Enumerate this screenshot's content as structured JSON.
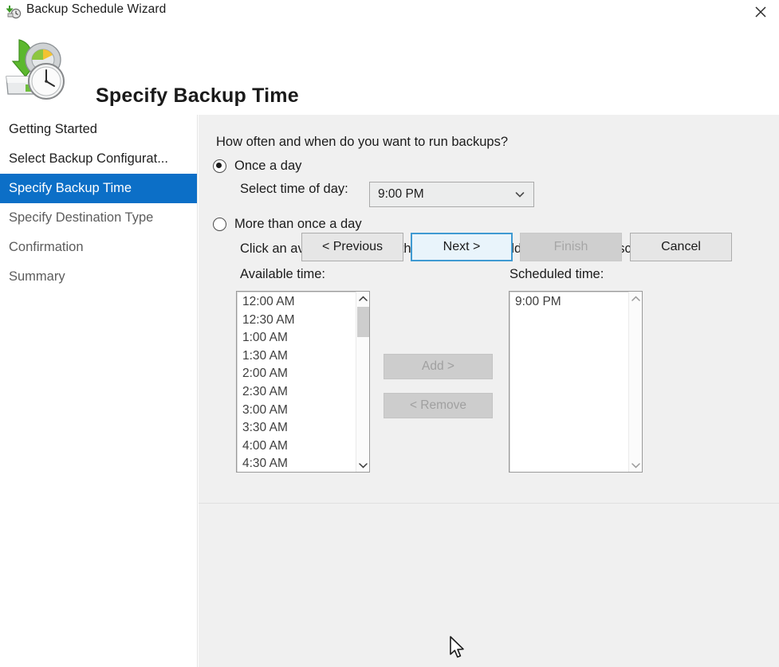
{
  "window": {
    "title": "Backup Schedule Wizard",
    "title_icon": "backup-schedule-icon",
    "close_icon": "close-icon"
  },
  "header": {
    "icon": "backup-clock-icon",
    "title": "Specify Backup Time"
  },
  "sidebar": {
    "items": [
      {
        "label": "Getting Started",
        "state": "normal"
      },
      {
        "label": "Select Backup Configurat...",
        "state": "normal"
      },
      {
        "label": "Specify Backup Time",
        "state": "selected"
      },
      {
        "label": "Specify Destination Type",
        "state": "dim"
      },
      {
        "label": "Confirmation",
        "state": "dim"
      },
      {
        "label": "Summary",
        "state": "dim"
      }
    ],
    "selected_color": "#0c6fc7"
  },
  "main": {
    "question": "How often and when do you want to run backups?",
    "options": {
      "once_a_day": {
        "label": "Once a day",
        "selected": true
      },
      "more_than_once": {
        "label": "More than once a day",
        "selected": false
      }
    },
    "time_of_day": {
      "label": "Select time of day:",
      "value": "9:00 PM",
      "dropdown_icon": "chevron-down-icon"
    },
    "hint": "Click an available time and then click Add to add it to the backup schedule.",
    "available": {
      "label": "Available time:",
      "items": [
        "12:00 AM",
        "12:30 AM",
        "1:00 AM",
        "1:30 AM",
        "2:00 AM",
        "2:30 AM",
        "3:00 AM",
        "3:30 AM",
        "4:00 AM",
        "4:30 AM"
      ],
      "scroll_up_icon": "chevron-up-icon",
      "scroll_down_icon": "chevron-down-icon"
    },
    "scheduled": {
      "label": "Scheduled time:",
      "items": [
        "9:00 PM"
      ],
      "scroll_up_icon": "chevron-up-icon",
      "scroll_down_icon": "chevron-down-icon"
    },
    "add_button": {
      "label": "Add >",
      "enabled": false
    },
    "remove_button": {
      "label": "< Remove",
      "enabled": false
    }
  },
  "footer": {
    "previous": {
      "label": "< Previous",
      "enabled": true
    },
    "next": {
      "label": "Next >",
      "enabled": true,
      "focused": true
    },
    "finish": {
      "label": "Finish",
      "enabled": false
    },
    "cancel": {
      "label": "Cancel",
      "enabled": true
    }
  },
  "cursor": {
    "icon": "mouse-pointer-icon"
  }
}
